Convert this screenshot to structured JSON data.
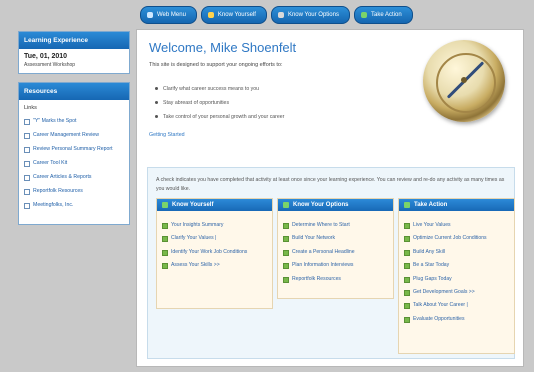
{
  "nav": [
    {
      "label": "Web Menu",
      "icon": "home-icon",
      "icon_color": "blue"
    },
    {
      "label": "Know Yourself",
      "icon": "user-icon",
      "icon_color": "yellow"
    },
    {
      "label": "Know Your Options",
      "icon": "options-icon",
      "icon_color": "gray"
    },
    {
      "label": "Take Action",
      "icon": "action-icon",
      "icon_color": "green"
    }
  ],
  "sidebar": {
    "learning_experience": {
      "title": "Learning Experience",
      "date": "Tue, 01, 2010",
      "subtitle": "Assessment Workshop"
    },
    "resources": {
      "title": "Resources",
      "links_header": "Links",
      "links": [
        "\"Y\" Marks the Spot",
        "Career Management Review",
        "Review Personal Summary Report",
        "Career Tool Kit",
        "Career Articles & Reports",
        "Reportfolk Resources",
        "Meetingfolks, Inc."
      ]
    }
  },
  "main": {
    "welcome": "Welcome, Mike Shoenfelt",
    "intro": "This site is designed to support your ongoing efforts to:",
    "bullets": [
      "Clarify what career success means to you",
      "Stay abreast of opportunities",
      "Take control of your personal growth and your career"
    ],
    "getting_started": "Getting Started",
    "panel_text": "A check indicates you have completed that activity at least once since your learning experience. You can review and re-do any activity as many times as you would like.",
    "columns": [
      {
        "title": "Know Yourself",
        "items": [
          "Your Insights Summary",
          "Clarify Your Values | ",
          "Identify Your Work Job Conditions",
          "Assess Your Skills >>"
        ]
      },
      {
        "title": "Know Your Options",
        "items": [
          "Determine Where to Start",
          "Build Your Network",
          "Create a Personal Headline",
          "Plan Information Interviews",
          "Reportfolk Resources"
        ]
      },
      {
        "title": "Take Action",
        "items": [
          "Live Your Values",
          "Optimize Current Job Conditions",
          "Build Any Skill",
          "Be a Star Today",
          "Plug Gaps Today",
          "Get Development Goals >>",
          "Talk About Your Career | ",
          "Evaluate Opportunities"
        ]
      }
    ]
  }
}
